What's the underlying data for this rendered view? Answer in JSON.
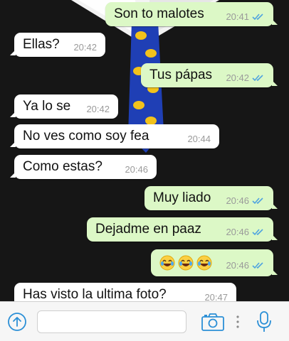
{
  "messages": [
    {
      "dir": "out",
      "text": "Son to malotes",
      "time": "20:41",
      "ticks": true
    },
    {
      "dir": "in",
      "text": "Ellas?",
      "time": "20:42"
    },
    {
      "dir": "out",
      "text": "Tus pápas",
      "time": "20:42",
      "ticks": true
    },
    {
      "dir": "in",
      "text": "Ya lo se",
      "time": "20:42"
    },
    {
      "dir": "in",
      "text": "No ves como soy fea",
      "time": "20:44"
    },
    {
      "dir": "in",
      "text": "Como estas?",
      "time": "20:46"
    },
    {
      "dir": "out",
      "text": "Muy liado",
      "time": "20:46",
      "ticks": true
    },
    {
      "dir": "out",
      "text": "Dejadme en paaz",
      "time": "20:46",
      "ticks": true
    },
    {
      "dir": "out",
      "emoji": [
        "tears-of-joy",
        "tears-of-joy",
        "tears-of-joy"
      ],
      "time": "20:46",
      "ticks": true
    },
    {
      "dir": "in",
      "text": "Has visto la ultima foto?",
      "time": "20:47"
    }
  ],
  "input": {
    "placeholder": ""
  },
  "icons": {
    "send": "upload-arrow-icon",
    "camera": "camera-icon",
    "more": "more-dots-icon",
    "mic": "microphone-icon"
  },
  "colors": {
    "outgoing_bubble": "#dcf8c6",
    "incoming_bubble": "#ffffff",
    "accent": "#2b8fd6",
    "read_ticks": "#4fa3e0"
  }
}
